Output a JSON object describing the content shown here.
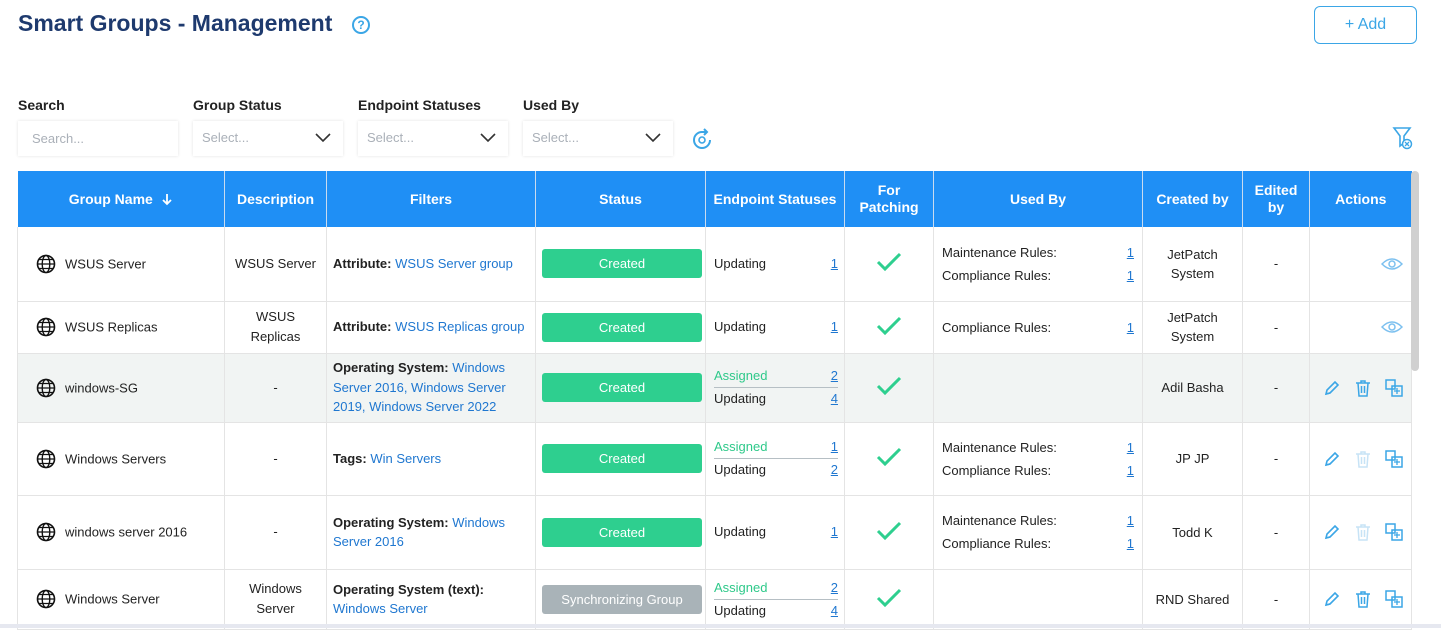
{
  "header": {
    "title": "Smart Groups - Management",
    "add_label": "+ Add"
  },
  "filters": {
    "search_label": "Search",
    "search_placeholder": "Search...",
    "group_status_label": "Group Status",
    "group_status_value": "Select...",
    "endpoint_statuses_label": "Endpoint Statuses",
    "endpoint_statuses_value": "Select...",
    "used_by_label": "Used By",
    "used_by_value": "Select..."
  },
  "columns": {
    "group_name": "Group Name",
    "description": "Description",
    "filters": "Filters",
    "status": "Status",
    "endpoint_statuses": "Endpoint Statuses",
    "for_patching_1": "For",
    "for_patching_2": "Patching",
    "used_by": "Used By",
    "created_by": "Created by",
    "edited_by_1": "Edited",
    "edited_by_2": "by",
    "actions": "Actions"
  },
  "rows": [
    {
      "name": "WSUS Server",
      "description": [
        "WSUS Server"
      ],
      "filter_label": "Attribute:",
      "filter_lines": [
        "WSUS Server group"
      ],
      "status": "Created",
      "endpoints": [
        {
          "label": "Updating",
          "count": "1"
        }
      ],
      "used_by": [
        {
          "label": "Maintenance Rules:",
          "count": "1"
        },
        {
          "label": "Compliance Rules:",
          "count": "1"
        }
      ],
      "created_by": [
        "JetPatch",
        "System"
      ],
      "edited_by": "-"
    },
    {
      "name": "WSUS Replicas",
      "description": [
        "WSUS Replicas"
      ],
      "filter_label": "Attribute:",
      "filter_lines": [
        "WSUS Replicas group"
      ],
      "status": "Created",
      "endpoints": [
        {
          "label": "Updating",
          "count": "1"
        }
      ],
      "used_by": [
        {
          "label": "Compliance Rules:",
          "count": "1"
        }
      ],
      "created_by": [
        "JetPatch",
        "System"
      ],
      "edited_by": "-"
    },
    {
      "name": "windows-SG",
      "description": [
        "-"
      ],
      "filter_label": "Operating System:",
      "filter_lines": [
        "Windows",
        "Server 2016, Windows Server",
        "2019, Windows Server 2022"
      ],
      "status": "Created",
      "endpoints": [
        {
          "label": "Assigned",
          "count": "2"
        },
        {
          "label": "Updating",
          "count": "4"
        }
      ],
      "used_by": [],
      "created_by": [
        "Adil Basha"
      ],
      "edited_by": "-"
    },
    {
      "name": "Windows Servers",
      "description": [
        "-"
      ],
      "filter_label": "Tags:",
      "filter_lines": [
        "Win Servers"
      ],
      "status": "Created",
      "endpoints": [
        {
          "label": "Assigned",
          "count": "1"
        },
        {
          "label": "Updating",
          "count": "2"
        }
      ],
      "used_by": [
        {
          "label": "Maintenance Rules:",
          "count": "1"
        },
        {
          "label": "Compliance Rules:",
          "count": "1"
        }
      ],
      "created_by": [
        "JP JP"
      ],
      "edited_by": "-"
    },
    {
      "name": "windows server 2016",
      "description": [
        "-"
      ],
      "filter_label": "Operating System:",
      "filter_lines": [
        "Windows",
        "Server 2016"
      ],
      "status": "Created",
      "endpoints": [
        {
          "label": "Updating",
          "count": "1"
        }
      ],
      "used_by": [
        {
          "label": "Maintenance Rules:",
          "count": "1"
        },
        {
          "label": "Compliance Rules:",
          "count": "1"
        }
      ],
      "created_by": [
        "Todd K"
      ],
      "edited_by": "-"
    },
    {
      "name": "Windows Server",
      "description": [
        "Windows",
        "Server"
      ],
      "filter_label": "Operating System (text):",
      "filter_lines": [
        "Windows Server"
      ],
      "status": "Synchronizing Group",
      "endpoints": [
        {
          "label": "Assigned",
          "count": "2"
        },
        {
          "label": "Updating",
          "count": "4"
        }
      ],
      "used_by": [],
      "created_by": [
        "RND Shared"
      ],
      "edited_by": "-"
    }
  ],
  "colors": {
    "accent": "#1f8ff5",
    "title": "#1e3a6e",
    "status_created": "#2ecf8f",
    "status_sync": "#a9b3b8",
    "check": "#2ecf8f",
    "link": "#1f77d0"
  }
}
